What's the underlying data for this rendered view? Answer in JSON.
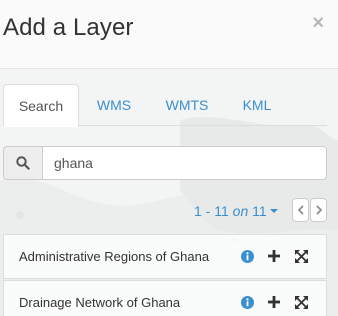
{
  "dialog": {
    "title": "Add a Layer",
    "close_label": "×"
  },
  "tabs": [
    {
      "label": "Search",
      "active": true
    },
    {
      "label": "WMS",
      "active": false
    },
    {
      "label": "WMTS",
      "active": false
    },
    {
      "label": "KML",
      "active": false
    }
  ],
  "search": {
    "value": "ghana",
    "icon": "search-icon"
  },
  "pagination": {
    "range": "1 - 11",
    "on": "on",
    "total": "11"
  },
  "results": [
    {
      "label": "Administrative Regions of Ghana"
    },
    {
      "label": "Drainage Network of Ghana"
    }
  ],
  "colors": {
    "accent": "#3b8fcf",
    "info": "#3b8fcf"
  }
}
